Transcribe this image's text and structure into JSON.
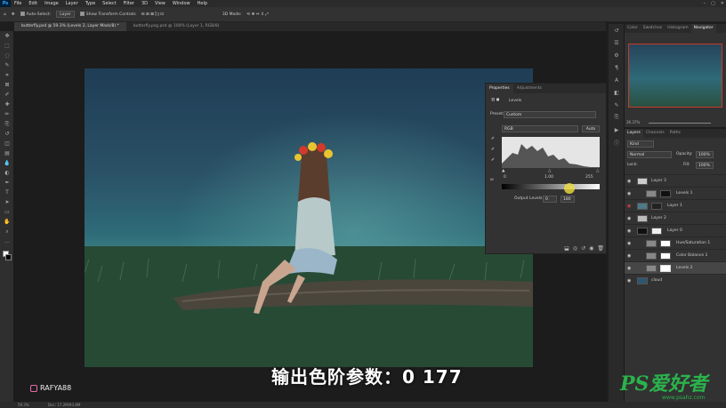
{
  "menu": [
    "File",
    "Edit",
    "Image",
    "Layer",
    "Type",
    "Select",
    "Filter",
    "3D",
    "View",
    "Window",
    "Help"
  ],
  "options": {
    "auto_select": "Auto-Select:",
    "auto_select_target": "Layer",
    "show_transform": "Show Transform Controls",
    "mode_3d": "3D Mode:"
  },
  "tabs": [
    "butterfly.psd @ 59.3% (Levels 2, Layer Mask/8) *",
    "butterfly.psg.psd @ 100% (Layer 1, RGB/8)"
  ],
  "tools": [
    "move-icon",
    "marquee-icon",
    "lasso-icon",
    "quick-select-icon",
    "crop-icon",
    "frame-icon",
    "eyedropper-icon",
    "healing-icon",
    "brush-icon",
    "stamp-icon",
    "history-brush-icon",
    "eraser-icon",
    "gradient-icon",
    "blur-icon",
    "dodge-icon",
    "pen-icon",
    "type-icon",
    "path-select-icon",
    "shape-icon",
    "hand-icon",
    "zoom-icon",
    "more-icon"
  ],
  "tool_glyphs": [
    "✥",
    "⬚",
    "◌",
    "✎",
    "⌗",
    "⊠",
    "✐",
    "✚",
    "✏",
    "⎘",
    "↺",
    "◫",
    "▤",
    "💧",
    "◐",
    "✒",
    "T",
    "➤",
    "▭",
    "✋",
    "⌕",
    "…"
  ],
  "caption": "输出色阶参数：0 177",
  "watermark": {
    "brand": "RAFYA88",
    "ps_logo": "PS爱好者",
    "url": "www.psahz.com"
  },
  "status": {
    "zoom": "59.3%",
    "doc": "Doc: 17.2M/93.8M"
  },
  "navigator": {
    "tabs": [
      "Color",
      "Swatches",
      "Histogram",
      "Navigator"
    ],
    "zoom": "36.37%"
  },
  "layers_panel": {
    "tabs": [
      "Layers",
      "Channels",
      "Paths"
    ],
    "kind": "Kind",
    "blend": "Normal",
    "opacity_label": "Opacity:",
    "opacity": "100%",
    "lock_label": "Lock:",
    "fill_label": "Fill:",
    "fill": "100%",
    "layers": [
      {
        "name": "Layer 3"
      },
      {
        "name": "Levels 1"
      },
      {
        "name": "Layer 1"
      },
      {
        "name": "Layer 2"
      },
      {
        "name": "Layer 0"
      },
      {
        "name": "Hue/Saturation 1"
      },
      {
        "name": "Color Balance 1"
      },
      {
        "name": "Levels 2"
      },
      {
        "name": "cloud"
      }
    ]
  },
  "properties": {
    "tabs": [
      "Properties",
      "Adjustments"
    ],
    "panel_title": "Levels",
    "preset_label": "Preset:",
    "preset_value": "Custom",
    "channel": "RGB",
    "auto_button": "Auto",
    "input_black": "0",
    "input_gamma": "1.00",
    "input_white": "255",
    "output_label": "Output Levels:",
    "output_black": "0",
    "output_white": "180"
  }
}
